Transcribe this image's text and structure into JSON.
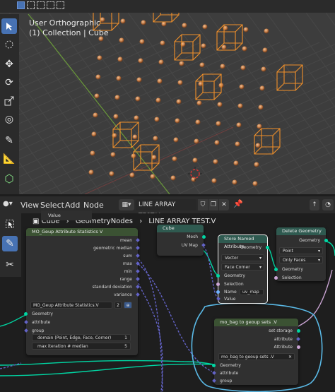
{
  "viewport": {
    "view_name": "User Orthographic",
    "collection_line": "(1) Collection | Cube"
  },
  "node_editor": {
    "menus": [
      "View",
      "Select",
      "Add",
      "Node"
    ],
    "node_group_name": "LINE ARRAY TEST.V",
    "breadcrumb": {
      "object": "Cube",
      "modifier": "GeometryNodes",
      "group": "LINE ARRAY TEST.V"
    },
    "ghost_label": "Value",
    "stats_node": {
      "title": "MO_Geup Attribute Statistics V",
      "outputs": [
        "mean",
        "geometric median",
        "sum",
        "max",
        "min",
        "range",
        "standard deviation",
        "variance"
      ],
      "group_selector": "MO_Geup Attribute Statistics.V",
      "group_users": "2",
      "inputs": [
        "Geometry",
        "attribute",
        "group"
      ],
      "domain_field": "domain (Point, Edge, Face, Corner)",
      "domain_value": "1",
      "iteration_field": "max iteration # median",
      "iteration_value": "5"
    },
    "cube_node": {
      "title": "Cube",
      "outputs": [
        "Mesh",
        "UV Map"
      ]
    },
    "store_node": {
      "title": "Store Named Attribute",
      "output": "Geometry",
      "type_value": "Vector",
      "domain_value": "Face Corner",
      "inputs": [
        "Geometry",
        "Selection"
      ],
      "name_label": "Name",
      "name_value": "uv_map",
      "value_label": "Value"
    },
    "delete_node": {
      "title": "Delete Geometry",
      "output": "Geometry",
      "domain_value": "Point",
      "mode_value": "Only Faces",
      "inputs": [
        "Geometry",
        "Selection"
      ]
    },
    "bag_node": {
      "title": "mo_bag to geoup sets .V",
      "outputs": [
        "set storage",
        "attribute",
        "Attribute"
      ],
      "group_selector": "mo_bag to geoup sets .V",
      "inputs": [
        "Geometry",
        "attribute",
        "group"
      ]
    }
  },
  "colors": {
    "stats_header": "#3b5233",
    "cube_header": "#2f5a50",
    "store_header": "#2f5a50",
    "delete_header": "#2f5a50",
    "bag_header": "#3b5233",
    "selected_outline": "#f0f0f0",
    "annotation": "#5ab9e6",
    "cube_wire": "#f0902a"
  },
  "icons": {
    "editor_type": "node-editor-icon",
    "pin": "pin-icon",
    "shield": "fake-user-icon",
    "duplicate": "duplicate-icon",
    "close": "close-icon",
    "up": "parent-node-tree-icon",
    "overlay": "overlay-icon"
  }
}
